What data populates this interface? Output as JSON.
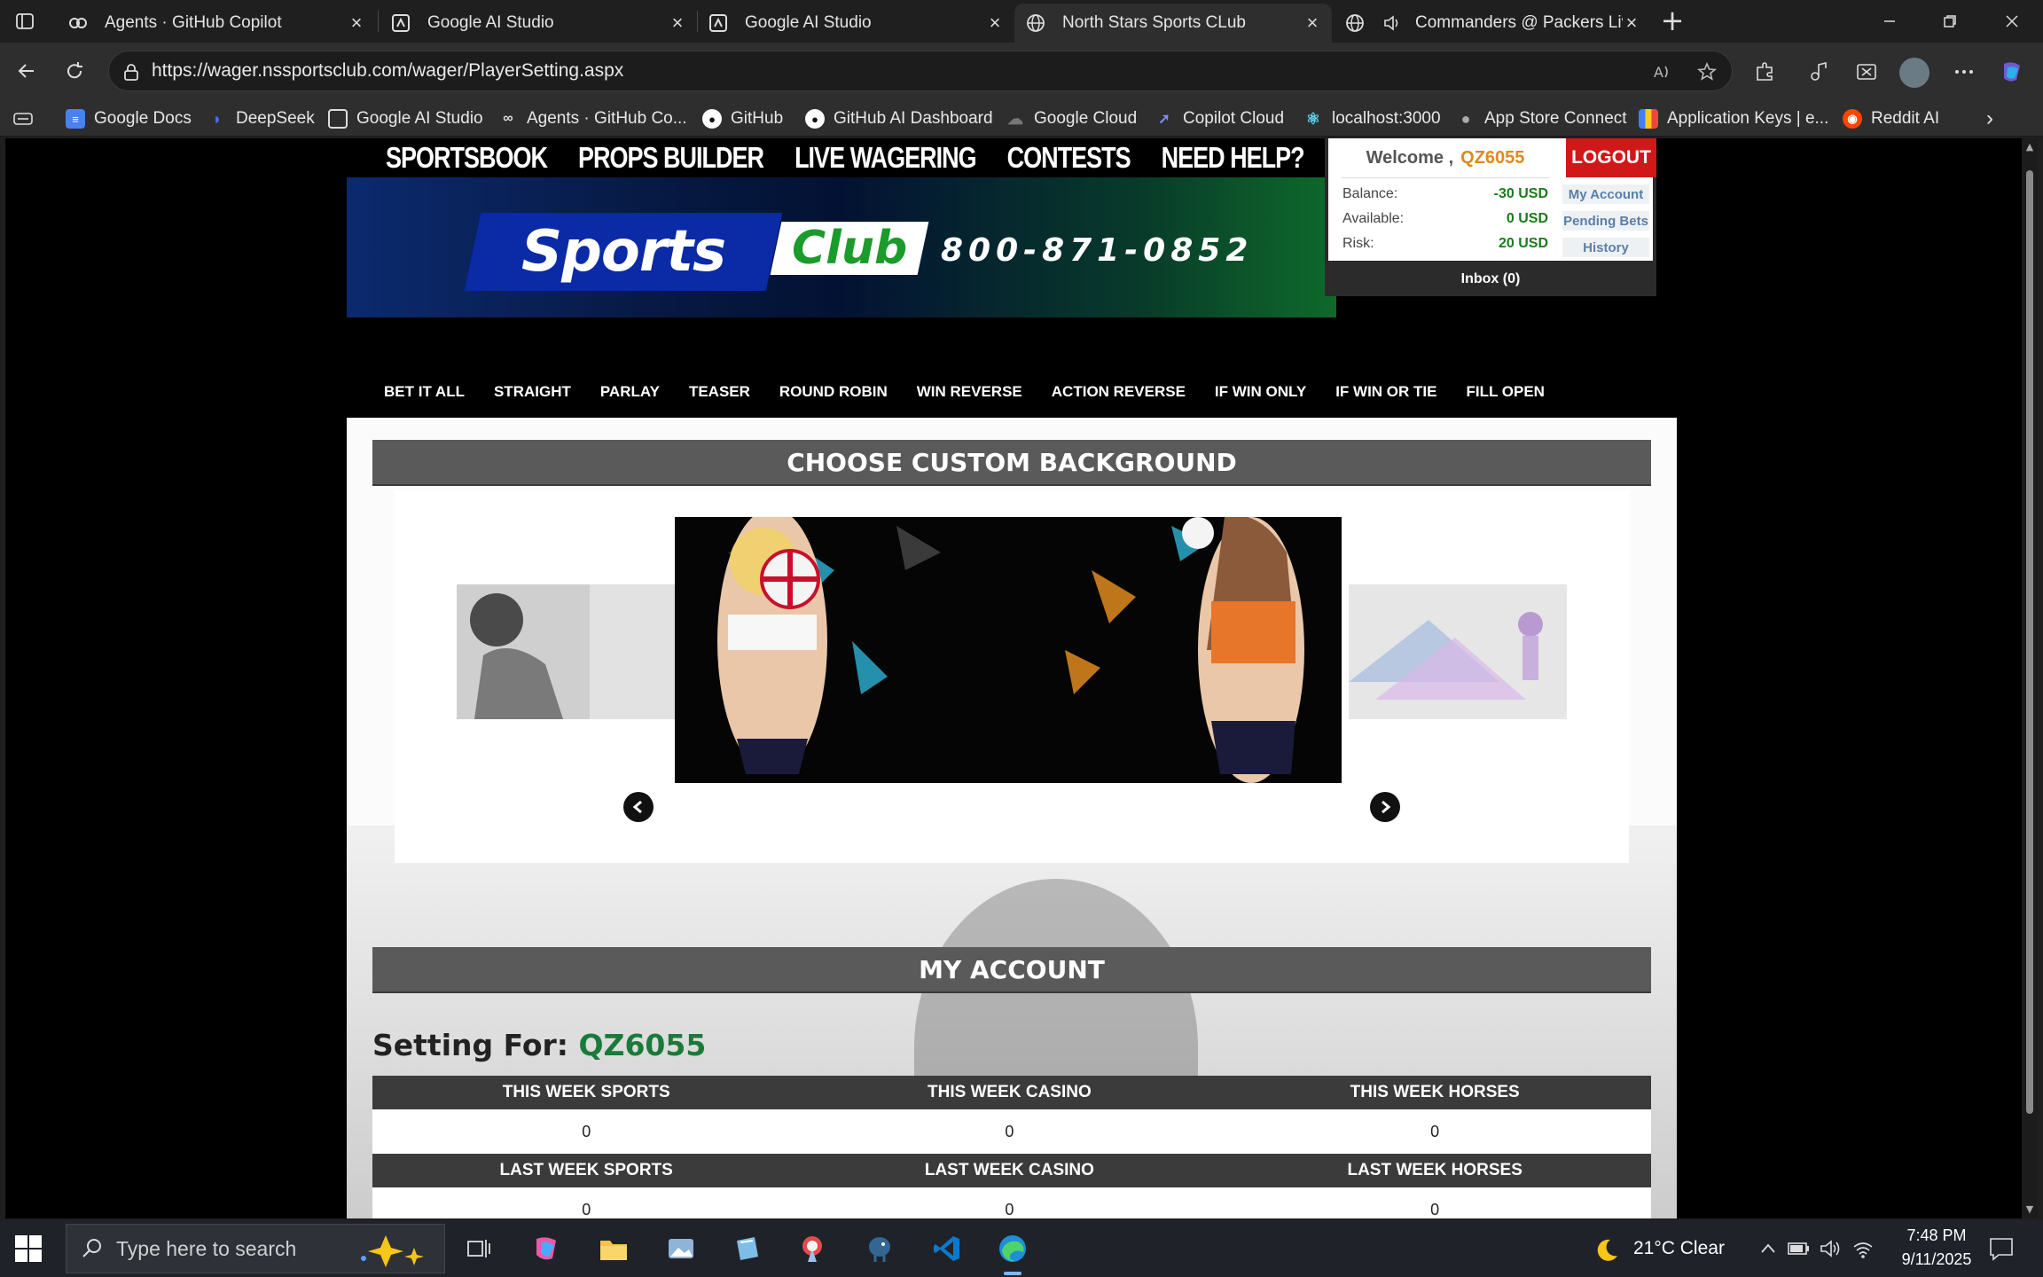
{
  "browser": {
    "tabs": [
      {
        "title": "Agents · GitHub Copilot",
        "icon": "copilot-icon"
      },
      {
        "title": "Google AI Studio",
        "icon": "ai-studio-icon"
      },
      {
        "title": "Google AI Studio",
        "icon": "ai-studio-icon"
      },
      {
        "title": "North Stars Sports CLub",
        "icon": "globe-icon",
        "active": true
      },
      {
        "title": "Commanders @ Packers Live",
        "icon": "globe-icon",
        "audio": true
      }
    ],
    "url": "https://wager.nssportsclub.com/wager/PlayerSetting.aspx",
    "bookmarks": [
      "Google Docs",
      "DeepSeek",
      "Google AI Studio",
      "Agents · GitHub Co...",
      "GitHub",
      "GitHub AI Dashboard",
      "Google Cloud",
      "Copilot Cloud",
      "localhost:3000",
      "App Store Connect",
      "Application Keys | e...",
      "Reddit AI"
    ]
  },
  "site": {
    "top_nav": [
      "SPORTSBOOK",
      "PROPS BUILDER",
      "LIVE WAGERING",
      "CONTESTS",
      "NEED HELP?"
    ],
    "logo_sports": "Sports",
    "logo_club": "Club",
    "phone": "800-871-0852",
    "account": {
      "welcome": "Welcome ,",
      "user_id": "QZ6055",
      "logout": "LOGOUT",
      "balance_label": "Balance:",
      "balance_value": "-30 USD",
      "available_label": "Available:",
      "available_value": "0 USD",
      "risk_label": "Risk:",
      "risk_value": "20 USD",
      "my_account": "My Account",
      "pending_bets": "Pending Bets",
      "history": "History",
      "inbox": "Inbox (0)"
    },
    "wager_nav": [
      "BET IT ALL",
      "STRAIGHT",
      "PARLAY",
      "TEASER",
      "ROUND ROBIN",
      "WIN REVERSE",
      "ACTION REVERSE",
      "IF WIN ONLY",
      "IF WIN OR TIE",
      "FILL OPEN"
    ],
    "background_title": "CHOOSE CUSTOM BACKGROUND",
    "my_account_title": "MY ACCOUNT",
    "setting_for_label": "Setting For:",
    "setting_for_user": "QZ6055",
    "stats": {
      "header1": [
        "THIS WEEK SPORTS",
        "THIS WEEK CASINO",
        "THIS WEEK HORSES"
      ],
      "row1": [
        "0",
        "0",
        "0"
      ],
      "header2": [
        "LAST WEEK SPORTS",
        "LAST WEEK CASINO",
        "LAST WEEK HORSES"
      ],
      "row2": [
        "0",
        "0",
        "0"
      ]
    }
  },
  "taskbar": {
    "search_placeholder": "Type here to search",
    "weather": "21°C  Clear",
    "time": "7:48 PM",
    "date": "9/11/2025"
  },
  "colors": {
    "logout_red": "#d01818",
    "user_orange": "#e08a1e",
    "money_green": "#1a7a1a",
    "section_gray": "#5a5a5a"
  }
}
